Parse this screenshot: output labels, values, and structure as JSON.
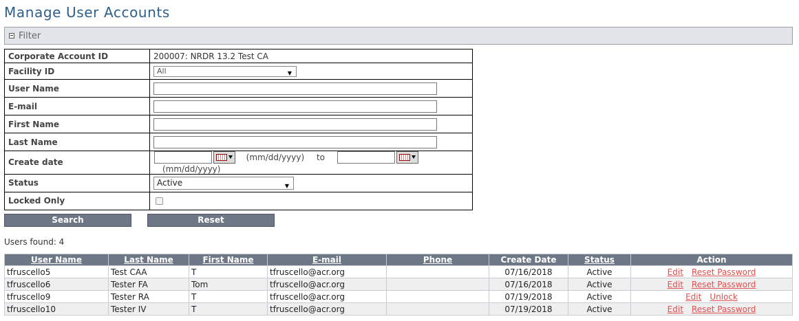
{
  "page": {
    "title": "Manage User Accounts"
  },
  "filter": {
    "label": "Filter",
    "rows": {
      "corporate_account_id": {
        "label": "Corporate Account ID",
        "value": "200007: NRDR 13.2 Test CA"
      },
      "facility_id": {
        "label": "Facility ID",
        "selected": "All"
      },
      "user_name": {
        "label": "User Name",
        "value": ""
      },
      "email": {
        "label": "E-mail",
        "value": ""
      },
      "first_name": {
        "label": "First Name",
        "value": ""
      },
      "last_name": {
        "label": "Last Name",
        "value": ""
      },
      "create_date": {
        "label": "Create date",
        "format_hint": "(mm/dd/yyyy)",
        "to_label": "to",
        "from_value": "",
        "to_value": ""
      },
      "status": {
        "label": "Status",
        "selected": "Active"
      },
      "locked_only": {
        "label": "Locked Only",
        "checked": false
      }
    },
    "search_label": "Search",
    "reset_label": "Reset"
  },
  "results": {
    "count_text": "Users found: 4",
    "columns": [
      "User Name",
      "Last Name",
      "First Name",
      "E-mail",
      "Phone",
      "Create Date",
      "Status",
      "Action"
    ],
    "rows": [
      {
        "user": "tfruscello5",
        "last": "Test CAA",
        "first": "T",
        "email": "tfruscello@acr.org",
        "phone": "",
        "date": "07/16/2018",
        "status": "Active",
        "action1": "Edit",
        "action2": "Reset Password"
      },
      {
        "user": "tfruscello6",
        "last": "Tester FA",
        "first": "Tom",
        "email": "tfruscello@acr.org",
        "phone": "",
        "date": "07/16/2018",
        "status": "Active",
        "action1": "Edit",
        "action2": "Reset Password"
      },
      {
        "user": "tfruscello9",
        "last": "Tester RA",
        "first": "T",
        "email": "tfruscello@acr.org",
        "phone": "",
        "date": "07/19/2018",
        "status": "Active",
        "action1": "Edit",
        "action2": "Unlock"
      },
      {
        "user": "tfruscello10",
        "last": "Tester IV",
        "first": "T",
        "email": "tfruscello@acr.org",
        "phone": "",
        "date": "07/19/2018",
        "status": "Active",
        "action1": "Edit",
        "action2": "Reset Password"
      }
    ]
  }
}
